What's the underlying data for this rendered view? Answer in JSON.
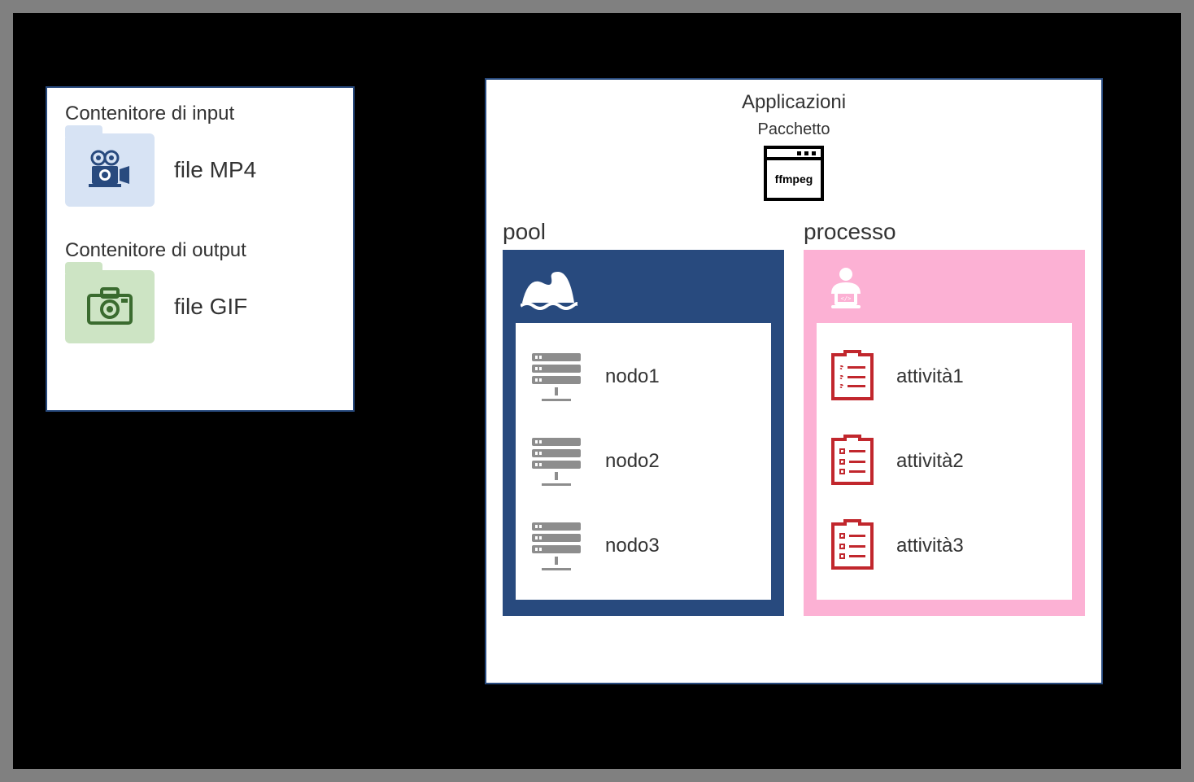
{
  "storage": {
    "input_title": "Contenitore di input",
    "input_file": "file MP4",
    "output_title": "Contenitore di output",
    "output_file": "file GIF"
  },
  "batch": {
    "apps_title": "Applicazioni",
    "package_title": "Pacchetto",
    "package_cmd": "ffmpeg",
    "pool": {
      "title": "pool",
      "nodes": [
        "nodo1",
        "nodo2",
        "nodo3"
      ]
    },
    "process": {
      "title": "processo",
      "tasks": [
        "attività1",
        "attività2",
        "attività3"
      ]
    }
  }
}
